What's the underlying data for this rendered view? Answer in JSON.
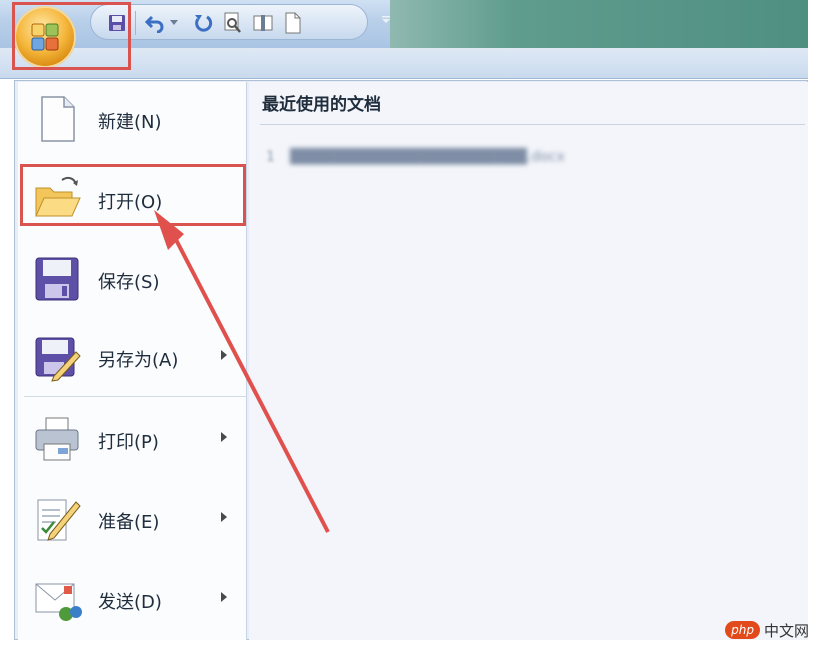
{
  "menu": {
    "items": [
      {
        "label": "新建(N)",
        "icon": "new-document-icon",
        "has_submenu": false
      },
      {
        "label": "打开(O)",
        "icon": "open-folder-icon",
        "has_submenu": false
      },
      {
        "label": "保存(S)",
        "icon": "save-disk-icon",
        "has_submenu": false
      },
      {
        "label": "另存为(A)",
        "icon": "save-as-icon",
        "has_submenu": true
      },
      {
        "label": "打印(P)",
        "icon": "printer-icon",
        "has_submenu": true
      },
      {
        "label": "准备(E)",
        "icon": "prepare-document-icon",
        "has_submenu": true
      },
      {
        "label": "发送(D)",
        "icon": "send-icon",
        "has_submenu": true
      }
    ]
  },
  "recent": {
    "title": "最近使用的文档",
    "items": [
      {
        "number": "1",
        "name": "██████████████████████.docx"
      }
    ]
  },
  "watermark": {
    "badge": "php",
    "text": "中文网"
  },
  "colors": {
    "highlight": "#d9534f",
    "office_orange": "#f5b73d"
  }
}
